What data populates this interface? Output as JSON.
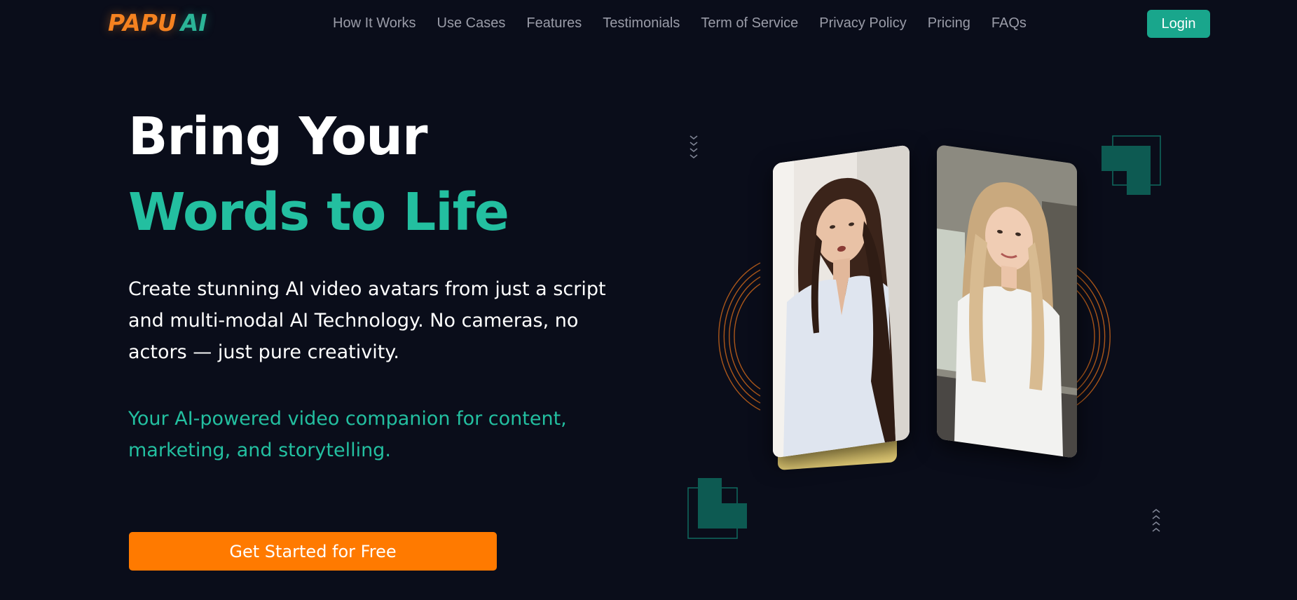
{
  "brand": {
    "logo_primary": "PAPU",
    "logo_secondary": "AI",
    "primary_color": "#f58220",
    "accent_color": "#2bb597"
  },
  "nav": {
    "links": [
      "How It Works",
      "Use Cases",
      "Features",
      "Testimonials",
      "Term of Service",
      "Privacy Policy",
      "Pricing",
      "FAQs"
    ],
    "login_label": "Login"
  },
  "hero": {
    "headline_line1": "Bring Your",
    "headline_line2": "Words to Life",
    "description": "Create stunning AI video avatars from just a script and multi-modal AI Technology. No cameras, no actors — just pure creativity.",
    "tagline": "Your AI-powered video companion for content, marketing, and storytelling.",
    "cta_label": "Get Started for Free"
  },
  "visual": {
    "avatars": [
      "brunette-avatar",
      "blonde-avatar"
    ],
    "decor_colors": {
      "teal": "#0d5a52",
      "orange": "#c8641a"
    }
  }
}
